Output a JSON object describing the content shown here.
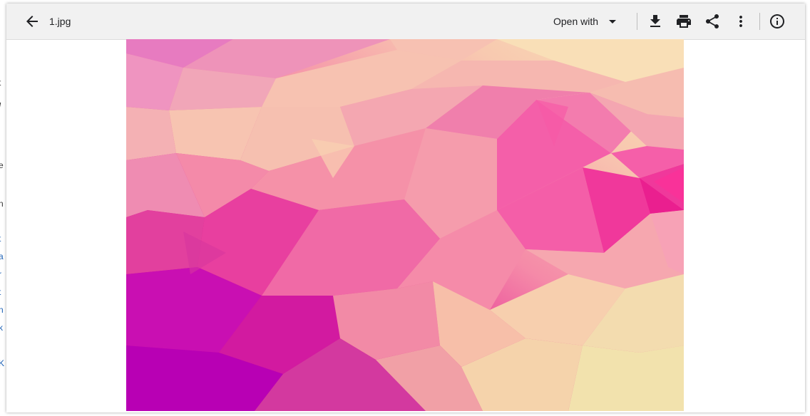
{
  "viewer": {
    "file_name": "1.jpg",
    "open_with_label": "Open with"
  },
  "toolbar": {
    "icons": [
      "back-arrow-icon",
      "chevron-down-icon",
      "download-icon",
      "print-icon",
      "share-icon",
      "more-vert-icon",
      "info-icon"
    ]
  },
  "background_page": {
    "edge_glyphs": [
      "t",
      "/",
      "e",
      "n",
      "t",
      "a",
      "r",
      "t",
      "n",
      "k",
      "l",
      "K"
    ]
  },
  "colors": {
    "header_bg": "#f1f1f1",
    "icon_color": "#202124",
    "link_blue": "#1a5fb4",
    "image_palette": [
      "#c400b8",
      "#e4007e",
      "#f55fa7",
      "#f7a7b0",
      "#f9d9b3",
      "#f4e3b0"
    ]
  }
}
